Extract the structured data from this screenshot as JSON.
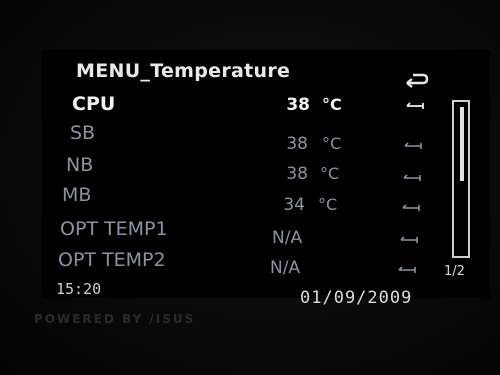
{
  "header": {
    "title": "MENU_Temperature"
  },
  "rows": [
    {
      "label": "CPU",
      "value": "38",
      "unit": "°C"
    },
    {
      "label": "SB",
      "value": "38",
      "unit": "°C"
    },
    {
      "label": "NB",
      "value": "38",
      "unit": "°C"
    },
    {
      "label": "MB",
      "value": "34",
      "unit": "°C"
    },
    {
      "label": "OPT TEMP1",
      "value": "N/A",
      "unit": ""
    },
    {
      "label": "OPT TEMP2",
      "value": "N/A",
      "unit": ""
    }
  ],
  "pagination": {
    "page": "1/2"
  },
  "footer": {
    "time": "15:20",
    "date": "01/09/2009",
    "branding": "POWERED BY /ISUS"
  },
  "colors": {
    "active": "#f2f2f2",
    "inactive": "#8a93a3",
    "background": "#000000"
  },
  "icons": {
    "back": "back-arrow-icon",
    "row_action": "row-arrow-icon"
  }
}
